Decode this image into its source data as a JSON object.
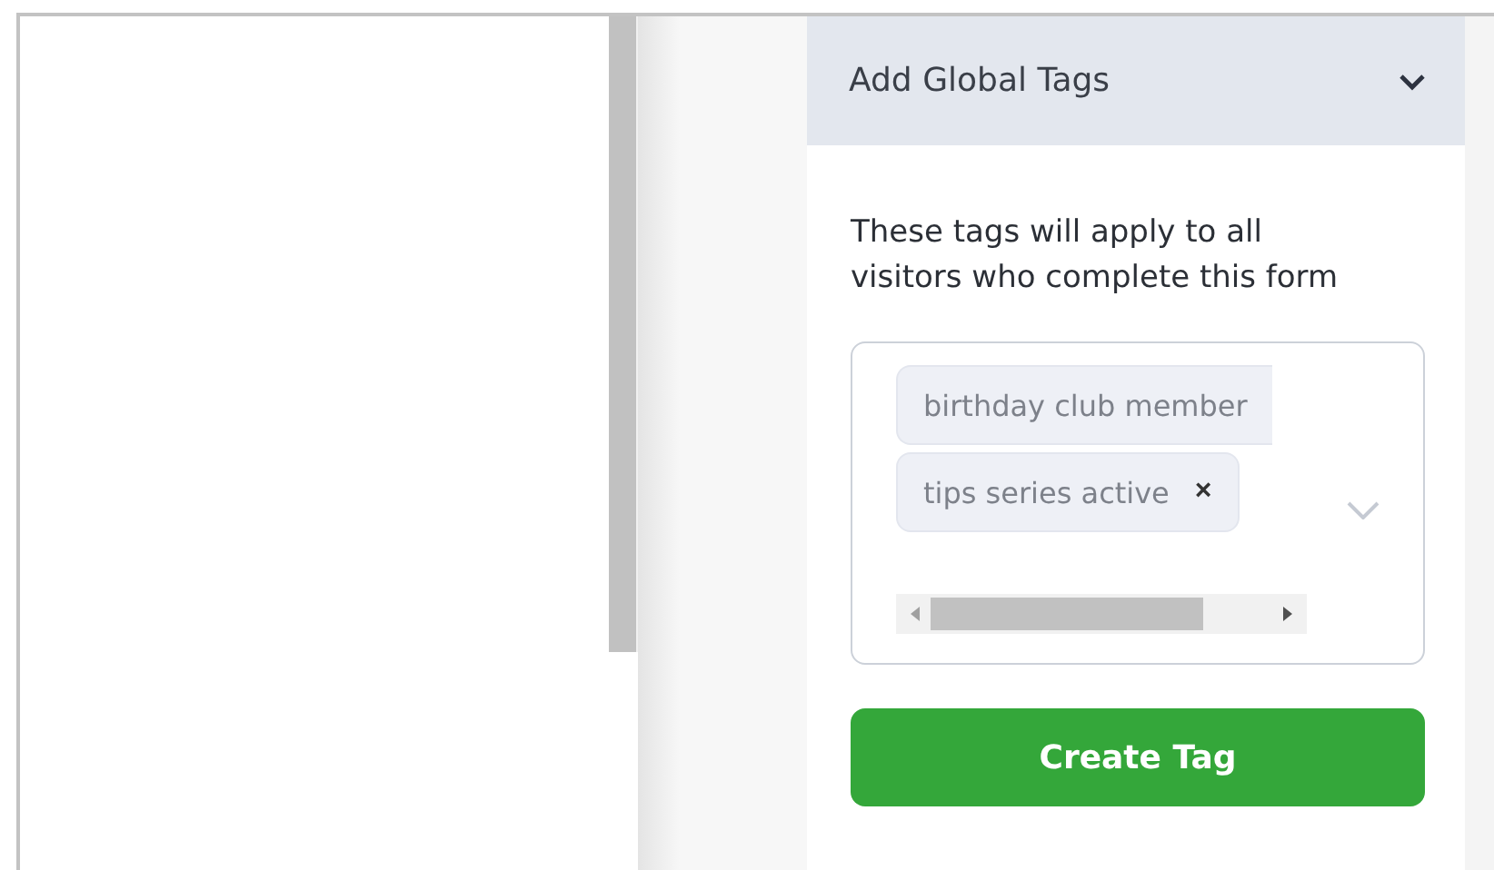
{
  "panel": {
    "title": "Add Global Tags",
    "expanded": true
  },
  "description": "These tags will apply to all visitors who complete this form",
  "tags": [
    {
      "label": "birthday club member"
    },
    {
      "label": "tips series active",
      "remove": "×"
    }
  ],
  "button": "Create Tag"
}
